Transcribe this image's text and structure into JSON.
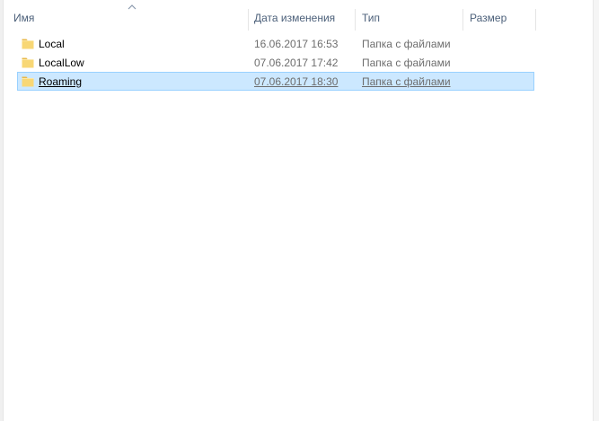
{
  "columns": {
    "name": "Имя",
    "date": "Дата изменения",
    "type": "Тип",
    "size": "Размер"
  },
  "sort": {
    "column": "name",
    "direction": "ascending",
    "icon": "sort-ascending-icon"
  },
  "files": [
    {
      "name": "Local",
      "date": "16.06.2017 16:53",
      "type": "Папка с файлами",
      "size": "",
      "icon": "folder-icon",
      "selected": false
    },
    {
      "name": "LocalLow",
      "date": "07.06.2017 17:42",
      "type": "Папка с файлами",
      "size": "",
      "icon": "folder-icon",
      "selected": false
    },
    {
      "name": "Roaming",
      "date": "07.06.2017 18:30",
      "type": "Папка с файлами",
      "size": "",
      "icon": "folder-icon",
      "selected": true
    }
  ],
  "colors": {
    "header_text": "#4c607a",
    "selection_bg": "#cce8ff",
    "selection_border": "#99d1ff",
    "folder": "#f8d775",
    "secondary_text": "#6d6d6d"
  }
}
